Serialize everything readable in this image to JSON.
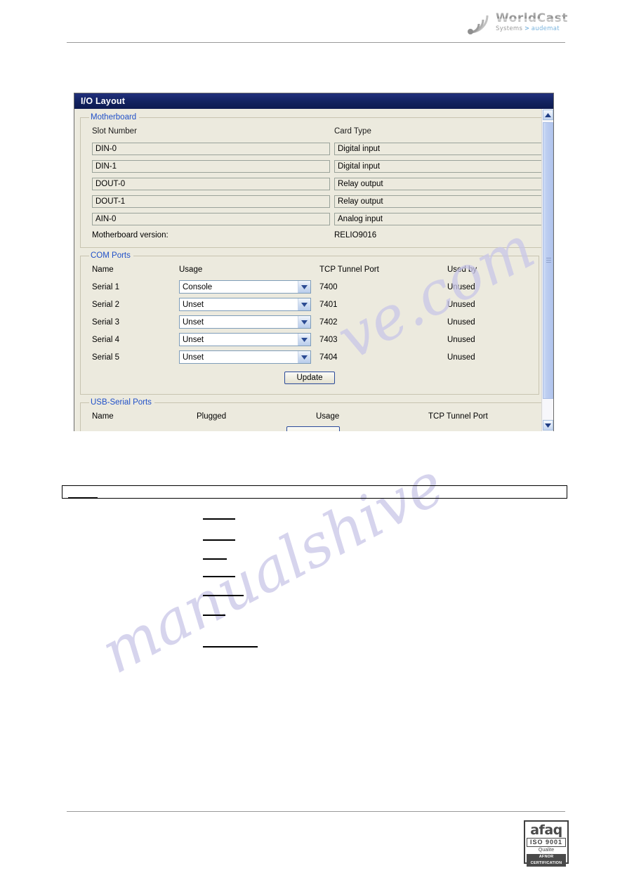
{
  "brand": {
    "name": "WorldCast",
    "tagline_systems": "Systems",
    "tagline_arrow": ">",
    "tagline_audemat": "audemat",
    "logo_icon": "signal-waves-icon"
  },
  "window": {
    "title": "I/O Layout"
  },
  "motherboard": {
    "legend": "Motherboard",
    "columns": [
      "Slot Number",
      "Card Type"
    ],
    "rows": [
      {
        "slot": "DIN-0",
        "card": "Digital input"
      },
      {
        "slot": "DIN-1",
        "card": "Digital input"
      },
      {
        "slot": "DOUT-0",
        "card": "Relay output"
      },
      {
        "slot": "DOUT-1",
        "card": "Relay output"
      },
      {
        "slot": "AIN-0",
        "card": "Analog input"
      }
    ],
    "version_label": "Motherboard version:",
    "version_value": "RELIO9016"
  },
  "com_ports": {
    "legend": "COM Ports",
    "columns": [
      "Name",
      "Usage",
      "TCP Tunnel Port",
      "Used by"
    ],
    "rows": [
      {
        "name": "Serial 1",
        "usage": "Console",
        "tcp": "7400",
        "used_by": "Unused"
      },
      {
        "name": "Serial 2",
        "usage": "Unset",
        "tcp": "7401",
        "used_by": "Unused"
      },
      {
        "name": "Serial 3",
        "usage": "Unset",
        "tcp": "7402",
        "used_by": "Unused"
      },
      {
        "name": "Serial 4",
        "usage": "Unset",
        "tcp": "7403",
        "used_by": "Unused"
      },
      {
        "name": "Serial 5",
        "usage": "Unset",
        "tcp": "7404",
        "used_by": "Unused"
      }
    ],
    "usage_options": [
      "Unset",
      "Console"
    ],
    "update_label": "Update"
  },
  "usb_serial_ports": {
    "legend": "USB-Serial Ports",
    "columns": [
      "Name",
      "Plugged",
      "Usage",
      "TCP Tunnel Port"
    ]
  },
  "scrollbar": {
    "up_icon": "chevron-up-icon",
    "down_icon": "chevron-down-icon",
    "grip_icon": "grip-lines-icon"
  },
  "certification": {
    "mark": "afaq",
    "standard": "ISO 9001",
    "quality": "Qualite",
    "body": "AFNOR CERTIFICATION"
  },
  "watermark": {
    "text_right": "ve.com",
    "text_left": "manualshive"
  },
  "colors": {
    "titlebar": "#12225f",
    "legend_blue": "#2050c8",
    "panel_bg": "#eceade",
    "scroll_thumb": "#bccdf0",
    "button_border": "#2a4a9a"
  }
}
